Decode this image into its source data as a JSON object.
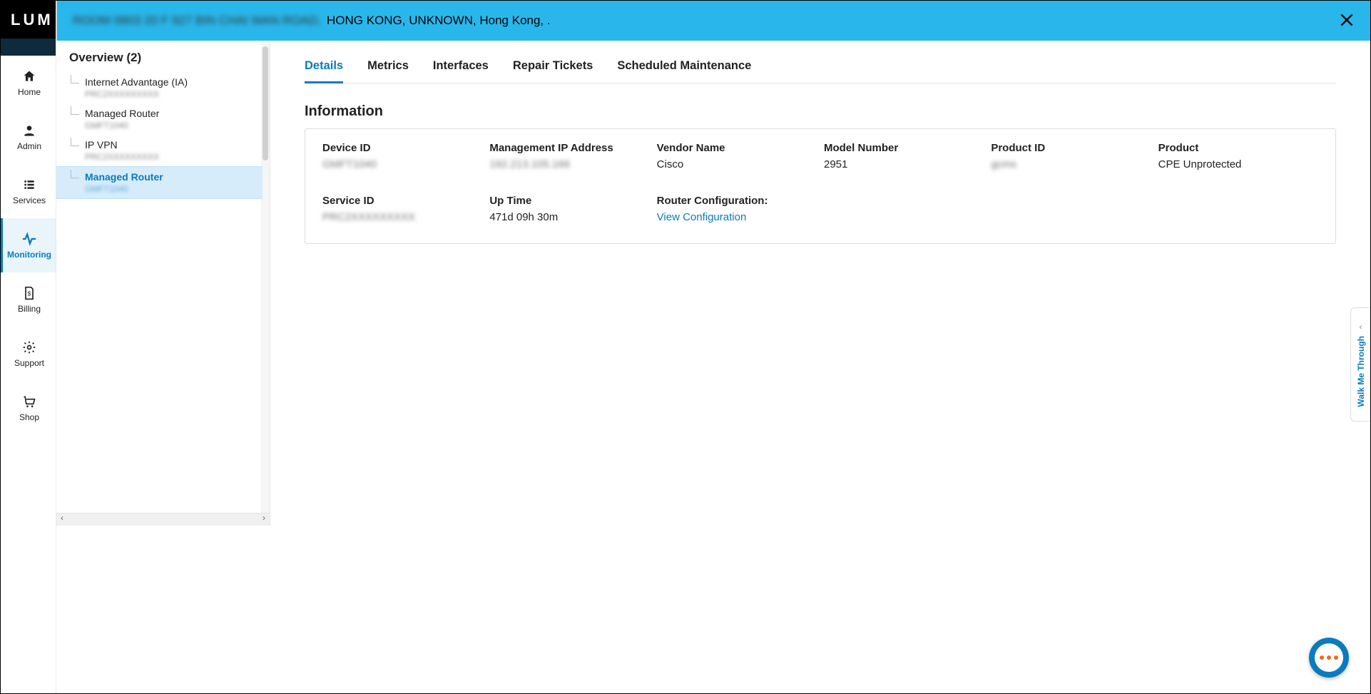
{
  "brand": "LUM",
  "leftnav": {
    "items": [
      {
        "key": "home",
        "label": "Home"
      },
      {
        "key": "admin",
        "label": "Admin"
      },
      {
        "key": "services",
        "label": "Services"
      },
      {
        "key": "monitoring",
        "label": "Monitoring"
      },
      {
        "key": "billing",
        "label": "Billing"
      },
      {
        "key": "support",
        "label": "Support"
      },
      {
        "key": "shop",
        "label": "Shop"
      }
    ],
    "active_key": "monitoring"
  },
  "bluebar": {
    "prefix_blurred": "ROOM 0803  20 F  927 BIN CHAI WAN ROAD,",
    "suffix": "HONG KONG, UNKNOWN, Hong Kong, ."
  },
  "overview": {
    "title": "Overview (2)",
    "nodes": [
      {
        "label": "Internet Advantage (IA)",
        "sub": "PRC2XXXXXXXXX"
      },
      {
        "label": "Managed Router",
        "sub": "GMFT1040"
      },
      {
        "label": "IP VPN",
        "sub": "PRC2XXXXXXXXX"
      },
      {
        "label": "Managed Router",
        "sub": "GMFT1040",
        "selected": true
      }
    ]
  },
  "tabs": [
    {
      "key": "details",
      "label": "Details",
      "active": true
    },
    {
      "key": "metrics",
      "label": "Metrics"
    },
    {
      "key": "interfaces",
      "label": "Interfaces"
    },
    {
      "key": "repair",
      "label": "Repair Tickets"
    },
    {
      "key": "maint",
      "label": "Scheduled Maintenance"
    }
  ],
  "info": {
    "section_title": "Information",
    "fields": {
      "device_id": {
        "label": "Device ID",
        "value": "GMFT1040",
        "blur": true
      },
      "mgmt_ip": {
        "label": "Management IP Address",
        "value": "192.213.105.166",
        "blur": true
      },
      "vendor": {
        "label": "Vendor Name",
        "value": "Cisco"
      },
      "model": {
        "label": "Model Number",
        "value": "2951"
      },
      "product_id": {
        "label": "Product ID",
        "value": "gcms",
        "blur": true
      },
      "product": {
        "label": "Product",
        "value": "CPE Unprotected"
      },
      "service_id": {
        "label": "Service ID",
        "value": "PRC2XXXXXXXXX",
        "blur": true
      },
      "uptime": {
        "label": "Up Time",
        "value": "471d 09h 30m"
      },
      "router_config": {
        "label": "Router Configuration:",
        "value": "View Configuration",
        "is_link": true
      }
    }
  },
  "walkme_label": "Walk Me Through"
}
